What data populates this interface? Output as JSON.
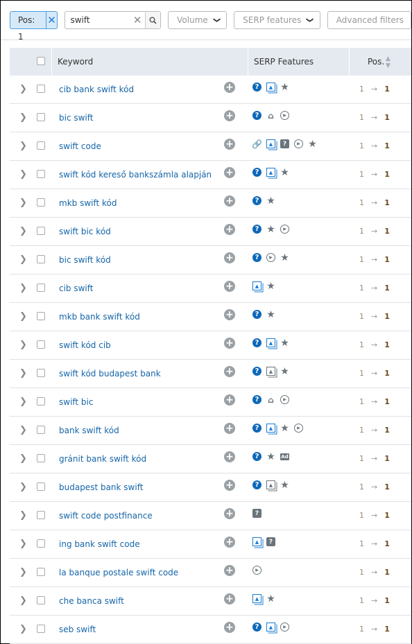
{
  "toolbar": {
    "pos_filter": "Pos: 1",
    "search_value": "swift",
    "volume_label": "Volume",
    "serp_label": "SERP features",
    "advanced_label": "Advanced filters"
  },
  "table": {
    "headers": {
      "keyword": "Keyword",
      "serp": "SERP Features",
      "pos": "Pos."
    },
    "rows": [
      {
        "keyword": "cib bank swift kód",
        "serp": [
          "q",
          "img",
          "star"
        ],
        "from": "1",
        "to": "1"
      },
      {
        "keyword": "bic swift",
        "serp": [
          "q",
          "grad",
          "play"
        ],
        "from": "1",
        "to": "1"
      },
      {
        "keyword": "swift code",
        "serp": [
          "link",
          "img",
          "fsq",
          "play",
          "star"
        ],
        "from": "1",
        "to": "1"
      },
      {
        "keyword": "swift kód kereső bankszámla alapján",
        "serp": [
          "q",
          "img",
          "star"
        ],
        "from": "1",
        "to": "1"
      },
      {
        "keyword": "mkb swift kód",
        "serp": [
          "q",
          "star"
        ],
        "from": "1",
        "to": "1"
      },
      {
        "keyword": "swift bic kód",
        "serp": [
          "q",
          "star",
          "play"
        ],
        "from": "1",
        "to": "1"
      },
      {
        "keyword": "bic swift kód",
        "serp": [
          "q",
          "play",
          "star"
        ],
        "from": "1",
        "to": "1"
      },
      {
        "keyword": "cib swift",
        "serp": [
          "img",
          "star"
        ],
        "from": "1",
        "to": "1"
      },
      {
        "keyword": "mkb bank swift kód",
        "serp": [
          "q",
          "star"
        ],
        "from": "1",
        "to": "1"
      },
      {
        "keyword": "swift kód cib",
        "serp": [
          "q",
          "img",
          "star"
        ],
        "from": "1",
        "to": "1"
      },
      {
        "keyword": "swift kód budapest bank",
        "serp": [
          "q",
          "img-gray",
          "star"
        ],
        "from": "1",
        "to": "1"
      },
      {
        "keyword": "swift bic",
        "serp": [
          "q",
          "grad",
          "play"
        ],
        "from": "1",
        "to": "1"
      },
      {
        "keyword": "bank swift kód",
        "serp": [
          "q",
          "img",
          "star",
          "play"
        ],
        "from": "1",
        "to": "1"
      },
      {
        "keyword": "gránit bank swift kód",
        "serp": [
          "q",
          "star",
          "ad"
        ],
        "from": "1",
        "to": "1"
      },
      {
        "keyword": "budapest bank swift",
        "serp": [
          "q",
          "img-gray",
          "star"
        ],
        "from": "1",
        "to": "1"
      },
      {
        "keyword": "swift code postfinance",
        "serp": [
          "fsq"
        ],
        "from": "1",
        "to": "1"
      },
      {
        "keyword": "ing bank swift code",
        "serp": [
          "img",
          "fsq"
        ],
        "from": "1",
        "to": "1"
      },
      {
        "keyword": "la banque postale swift code",
        "serp": [
          "play"
        ],
        "from": "1",
        "to": "1"
      },
      {
        "keyword": "che banca swift",
        "serp": [
          "img",
          "star"
        ],
        "from": "1",
        "to": "1"
      },
      {
        "keyword": "seb swift",
        "serp": [
          "q",
          "img",
          "play"
        ],
        "from": "1",
        "to": "1"
      }
    ]
  },
  "colors": {
    "link": "#1565a8",
    "accent": "#1f7ed6",
    "header_bg": "#e4eaf0"
  }
}
